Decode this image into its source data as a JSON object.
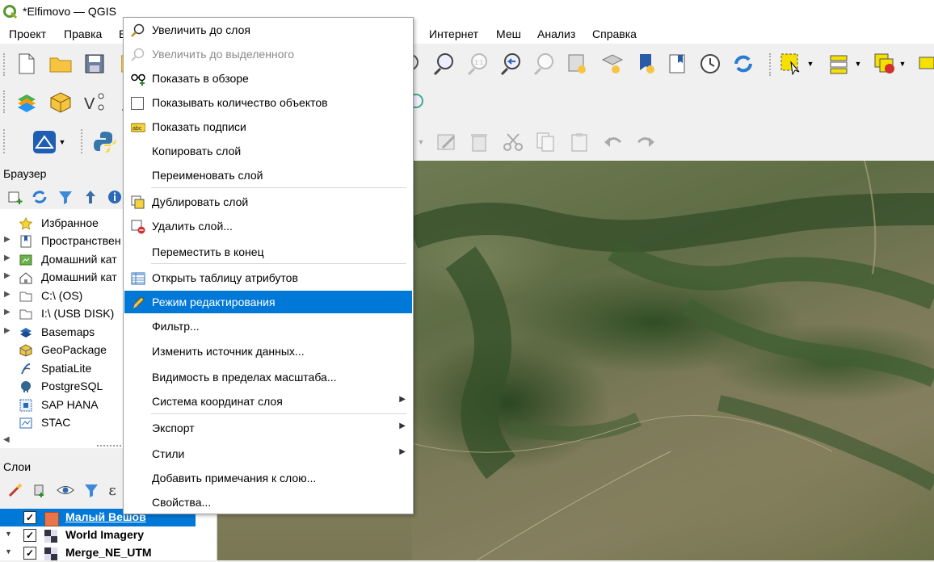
{
  "window": {
    "title": "*Elfimovo — QGIS"
  },
  "menubar": {
    "items": [
      "Проект",
      "Правка",
      "В",
      "Интернет",
      "Меш",
      "Анализ",
      "Справка"
    ]
  },
  "browser": {
    "title": "Браузер",
    "items": [
      {
        "label": "Избранное",
        "icon": "star-icon",
        "has_arrow": false
      },
      {
        "label": "Пространствен",
        "icon": "bookmark-icon",
        "has_arrow": true
      },
      {
        "label": "Домашний кат",
        "icon": "home-folder-icon",
        "has_arrow": true
      },
      {
        "label": "Домашний кат",
        "icon": "home-icon",
        "has_arrow": true
      },
      {
        "label": "C:\\ (OS)",
        "icon": "drive-icon",
        "has_arrow": true
      },
      {
        "label": "I:\\ (USB DISK)",
        "icon": "drive-icon",
        "has_arrow": true
      },
      {
        "label": "Basemaps",
        "icon": "basemaps-icon",
        "has_arrow": true
      },
      {
        "label": "GeoPackage",
        "icon": "geopackage-icon",
        "has_arrow": false
      },
      {
        "label": "SpatiaLite",
        "icon": "spatialite-icon",
        "has_arrow": false
      },
      {
        "label": "PostgreSQL",
        "icon": "postgresql-icon",
        "has_arrow": false
      },
      {
        "label": "SAP HANA",
        "icon": "saphana-icon",
        "has_arrow": false
      },
      {
        "label": "STAC",
        "icon": "stac-icon",
        "has_arrow": false
      }
    ]
  },
  "layers": {
    "title": "Слои",
    "items": [
      {
        "name": "Малый Вешов",
        "checked": true,
        "selected": true
      },
      {
        "name": "World Imagery",
        "checked": true,
        "selected": false
      },
      {
        "name": "Merge_NE_UTM",
        "checked": true,
        "selected": false
      }
    ]
  },
  "context_menu": {
    "items": [
      {
        "label": "Увеличить до слоя",
        "icon": "zoom-to-layer-icon",
        "disabled": false,
        "submenu": false
      },
      {
        "label": "Увеличить до выделенного",
        "icon": "zoom-to-selection-icon",
        "disabled": true,
        "submenu": false
      },
      {
        "label": "Показать в обзоре",
        "icon": "overview-icon",
        "disabled": false,
        "submenu": false
      },
      {
        "label": "Показывать количество объектов",
        "icon": "checkbox-icon",
        "disabled": false,
        "submenu": false
      },
      {
        "label": "Показать подписи",
        "icon": "labels-icon",
        "disabled": false,
        "submenu": false
      },
      {
        "label": "Копировать слой",
        "icon": "",
        "disabled": false,
        "submenu": false
      },
      {
        "label": "Переименовать слой",
        "icon": "",
        "disabled": false,
        "submenu": false
      },
      {
        "label": "Дублировать слой",
        "icon": "duplicate-layer-icon",
        "disabled": false,
        "submenu": false
      },
      {
        "label": "Удалить слой...",
        "icon": "remove-layer-icon",
        "disabled": false,
        "submenu": false
      },
      {
        "label": "Переместить в конец",
        "icon": "",
        "disabled": false,
        "submenu": false
      },
      {
        "label": "Открыть таблицу атрибутов",
        "icon": "attribute-table-icon",
        "disabled": false,
        "submenu": false
      },
      {
        "label": "Режим редактирования",
        "icon": "pencil-icon",
        "disabled": false,
        "submenu": false,
        "highlighted": true
      },
      {
        "label": "Фильтр...",
        "icon": "",
        "disabled": false,
        "submenu": false
      },
      {
        "label": "Изменить источник данных...",
        "icon": "",
        "disabled": false,
        "submenu": false
      },
      {
        "label": "Видимость в пределах масштаба...",
        "icon": "",
        "disabled": false,
        "submenu": false
      },
      {
        "label": "Система координат слоя",
        "icon": "",
        "disabled": false,
        "submenu": true
      },
      {
        "label": "Экспорт",
        "icon": "",
        "disabled": false,
        "submenu": true
      },
      {
        "label": "Стили",
        "icon": "",
        "disabled": false,
        "submenu": true
      },
      {
        "label": "Добавить примечания к слою...",
        "icon": "",
        "disabled": false,
        "submenu": false
      },
      {
        "label": "Свойства...",
        "icon": "",
        "disabled": false,
        "submenu": false
      }
    ]
  },
  "colors": {
    "highlight": "#0078d7",
    "layer_selected": "#0078d7",
    "layer_symbol_fill": "#e8744a"
  }
}
